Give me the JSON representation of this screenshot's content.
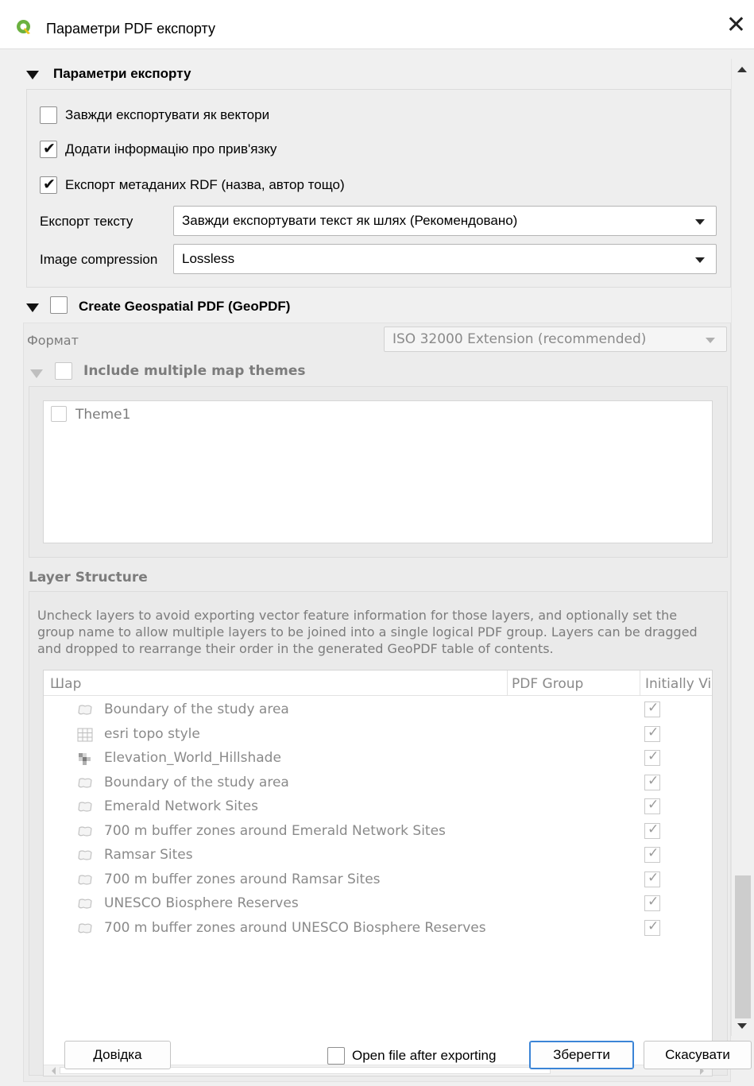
{
  "window": {
    "title": "Параметри PDF експорту",
    "close_glyph": "✕",
    "app_icon": "qgis-logo-icon"
  },
  "export_options": {
    "header": "Параметри експорту",
    "always_vectors": {
      "label": "Завжди експортувати як вектори",
      "checked": false
    },
    "georef": {
      "label": "Додати інформацію про прив'язку",
      "checked": true
    },
    "rdf_metadata": {
      "label": "Експорт метаданих RDF (назва, автор тощо)",
      "checked": true
    },
    "text_export": {
      "label": "Експорт тексту",
      "value": "Завжди експортувати текст як шлях (Рекомендовано)"
    },
    "image_compression": {
      "label": "Image compression",
      "value": "Lossless"
    }
  },
  "geopdf": {
    "header": "Create Geospatial PDF (GeoPDF)",
    "checked": false,
    "format": {
      "label": "Формат",
      "value": "ISO 32000 Extension (recommended)"
    },
    "map_themes": {
      "header": "Include multiple map themes",
      "checked": false,
      "items": [
        {
          "label": "Theme1",
          "checked": false
        }
      ]
    }
  },
  "layer_structure": {
    "header": "Layer Structure",
    "description": "Uncheck layers to avoid exporting vector feature information for those layers, and optionally set the group name to allow multiple layers to be joined into a single logical PDF group. Layers can be dragged and dropped to rearrange their order in the generated GeoPDF table of contents.",
    "columns": [
      "Шар",
      "PDF Group",
      "Initially Vi"
    ],
    "layers": [
      {
        "name": "Boundary of the study area",
        "icon": "polygon-layer-icon",
        "visible": true
      },
      {
        "name": "esri topo style",
        "icon": "raster-layer-icon",
        "visible": true
      },
      {
        "name": "Elevation_World_Hillshade",
        "icon": "hillshade-layer-icon",
        "visible": true
      },
      {
        "name": "Boundary of the study area",
        "icon": "polygon-layer-icon",
        "visible": true
      },
      {
        "name": "Emerald Network Sites",
        "icon": "polygon-layer-icon",
        "visible": true
      },
      {
        "name": "700 m buffer zones around Emerald Network Sites",
        "icon": "polygon-layer-icon",
        "visible": true
      },
      {
        "name": "Ramsar Sites",
        "icon": "polygon-layer-icon",
        "visible": true
      },
      {
        "name": "700 m buffer zones around Ramsar Sites",
        "icon": "polygon-layer-icon",
        "visible": true
      },
      {
        "name": "UNESCO Biosphere Reserves",
        "icon": "polygon-layer-icon",
        "visible": true
      },
      {
        "name": "700 m buffer zones around UNESCO Biosphere Reserves",
        "icon": "polygon-layer-icon",
        "visible": true
      }
    ],
    "check_glyph": "✓"
  },
  "footer": {
    "help_label": "Довідка",
    "open_after": {
      "label": "Open file after exporting",
      "checked": false
    },
    "save_label": "Зберегти",
    "cancel_label": "Скасувати"
  },
  "colors": {
    "accent": "#3a84d6",
    "qgis_green": "#6bb140",
    "qgis_yellow": "#f0c419"
  }
}
